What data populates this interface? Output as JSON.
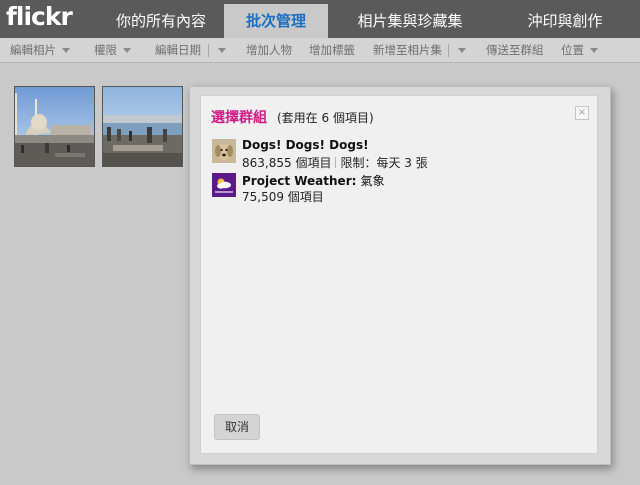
{
  "app": {
    "logo": "flickr"
  },
  "tabs": [
    {
      "label": "你的所有內容",
      "active": false
    },
    {
      "label": "批次管理",
      "active": true
    },
    {
      "label": "相片集與珍藏集",
      "active": false
    },
    {
      "label": "沖印與創作",
      "active": false
    }
  ],
  "toolbar": {
    "items": [
      {
        "label": "編輯相片",
        "dropdown": true
      },
      {
        "label": "權限",
        "dropdown": true
      },
      {
        "label": "編輯日期",
        "dropdown": true
      },
      {
        "label": "增加人物",
        "dropdown": false
      },
      {
        "label": "增加標籤",
        "dropdown": false
      },
      {
        "label": "新增至相片集",
        "dropdown": true
      },
      {
        "label": "傳送至群組",
        "dropdown": false
      },
      {
        "label": "位置",
        "dropdown": true
      }
    ]
  },
  "thumbnails": [
    {
      "icon": "photo-mosque-waterfront"
    },
    {
      "icon": "photo-harbor-crowd"
    }
  ],
  "dialog": {
    "title": "選擇群組",
    "subtitle": "(套用在 6 個項目)",
    "close_glyph": "×",
    "groups": [
      {
        "name": "Dogs! Dogs! Dogs!",
        "tag": "",
        "items": "863,855 個項目",
        "limit": "限制：每天 3 張",
        "icon": "dog-icon"
      },
      {
        "name": "Project Weather:",
        "tag": "氣象",
        "items": "75,509 個項目",
        "limit": "",
        "icon": "yahoo-weather-icon"
      }
    ],
    "cancel_label": "取消"
  },
  "colors": {
    "topbar": "#5a5a5a",
    "active_tab_text": "#1b6fc3",
    "dialog_title": "#d21a86",
    "background": "#c9c9c9"
  }
}
